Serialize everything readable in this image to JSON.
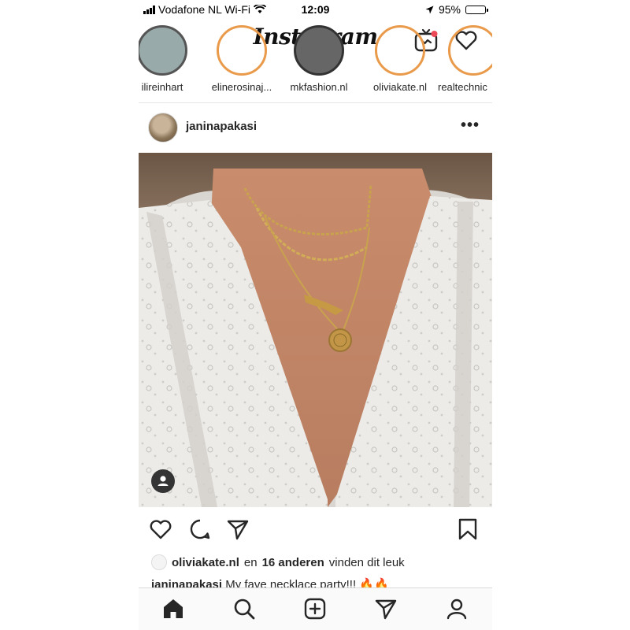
{
  "status_bar": {
    "carrier": "Vodafone NL Wi-Fi",
    "time": "12:09",
    "battery": "95%",
    "battery_level": 0.95
  },
  "header": {
    "logo": "Instagram",
    "icons": [
      "camera-icon",
      "igtv-icon",
      "heart-icon"
    ],
    "notification_dot_color": "#ed4956"
  },
  "stories": [
    {
      "name": "ilireinhart"
    },
    {
      "name": "elinerosinaj..."
    },
    {
      "name": "mkfashion.nl"
    },
    {
      "name": "oliviakate.nl"
    },
    {
      "name": "realtechnic"
    }
  ],
  "post": {
    "username": "janinapakasi",
    "more": "•••",
    "likes": {
      "user": "oliviakate.nl",
      "connector": "en",
      "others": "16 anderen",
      "suffix": "vinden dit leuk"
    },
    "caption": {
      "user": "janinapakasi",
      "text": "My fave necklace party!!! 🔥🔥"
    },
    "actions": [
      "heart-icon",
      "comment-icon",
      "share-icon",
      "bookmark-icon"
    ]
  },
  "tabbar": [
    "home-icon",
    "search-icon",
    "add-icon",
    "direct-icon",
    "profile-icon"
  ],
  "colors": {
    "story_ring": "#e99a4a",
    "text": "#262626",
    "divider": "#dbdbdb"
  }
}
